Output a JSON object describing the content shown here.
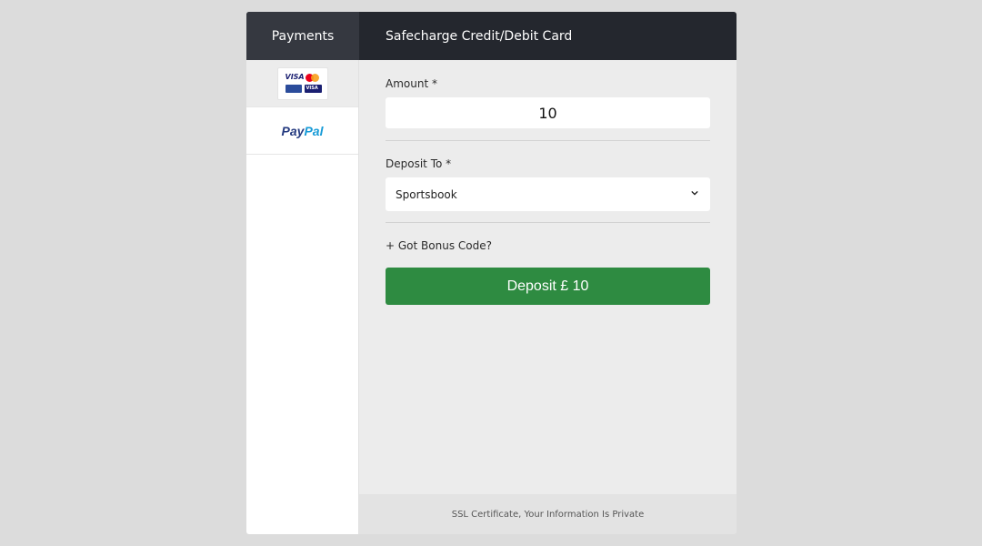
{
  "header": {
    "left_label": "Payments",
    "title": "Safecharge Credit/Debit Card"
  },
  "sidebar": {
    "methods": [
      {
        "name": "Credit/Debit Cards",
        "icon": "visa-mastercard-logo",
        "active": true
      },
      {
        "name": "PayPal",
        "logo_text_1": "Pay",
        "logo_text_2": "Pal",
        "icon": "paypal-logo",
        "active": false
      }
    ]
  },
  "form": {
    "amount_label": "Amount *",
    "amount_value": "10",
    "deposit_to_label": "Deposit To *",
    "deposit_to_value": "Sportsbook",
    "bonus_link": "+ Got Bonus Code?",
    "deposit_button": "Deposit £ 10"
  },
  "footer": {
    "text": "SSL Certificate, Your Information Is Private"
  },
  "colors": {
    "header_bg": "#24272e",
    "header_tab_bg": "#353840",
    "deposit_green": "#2e8b41",
    "page_bg": "#dcdcdc"
  }
}
